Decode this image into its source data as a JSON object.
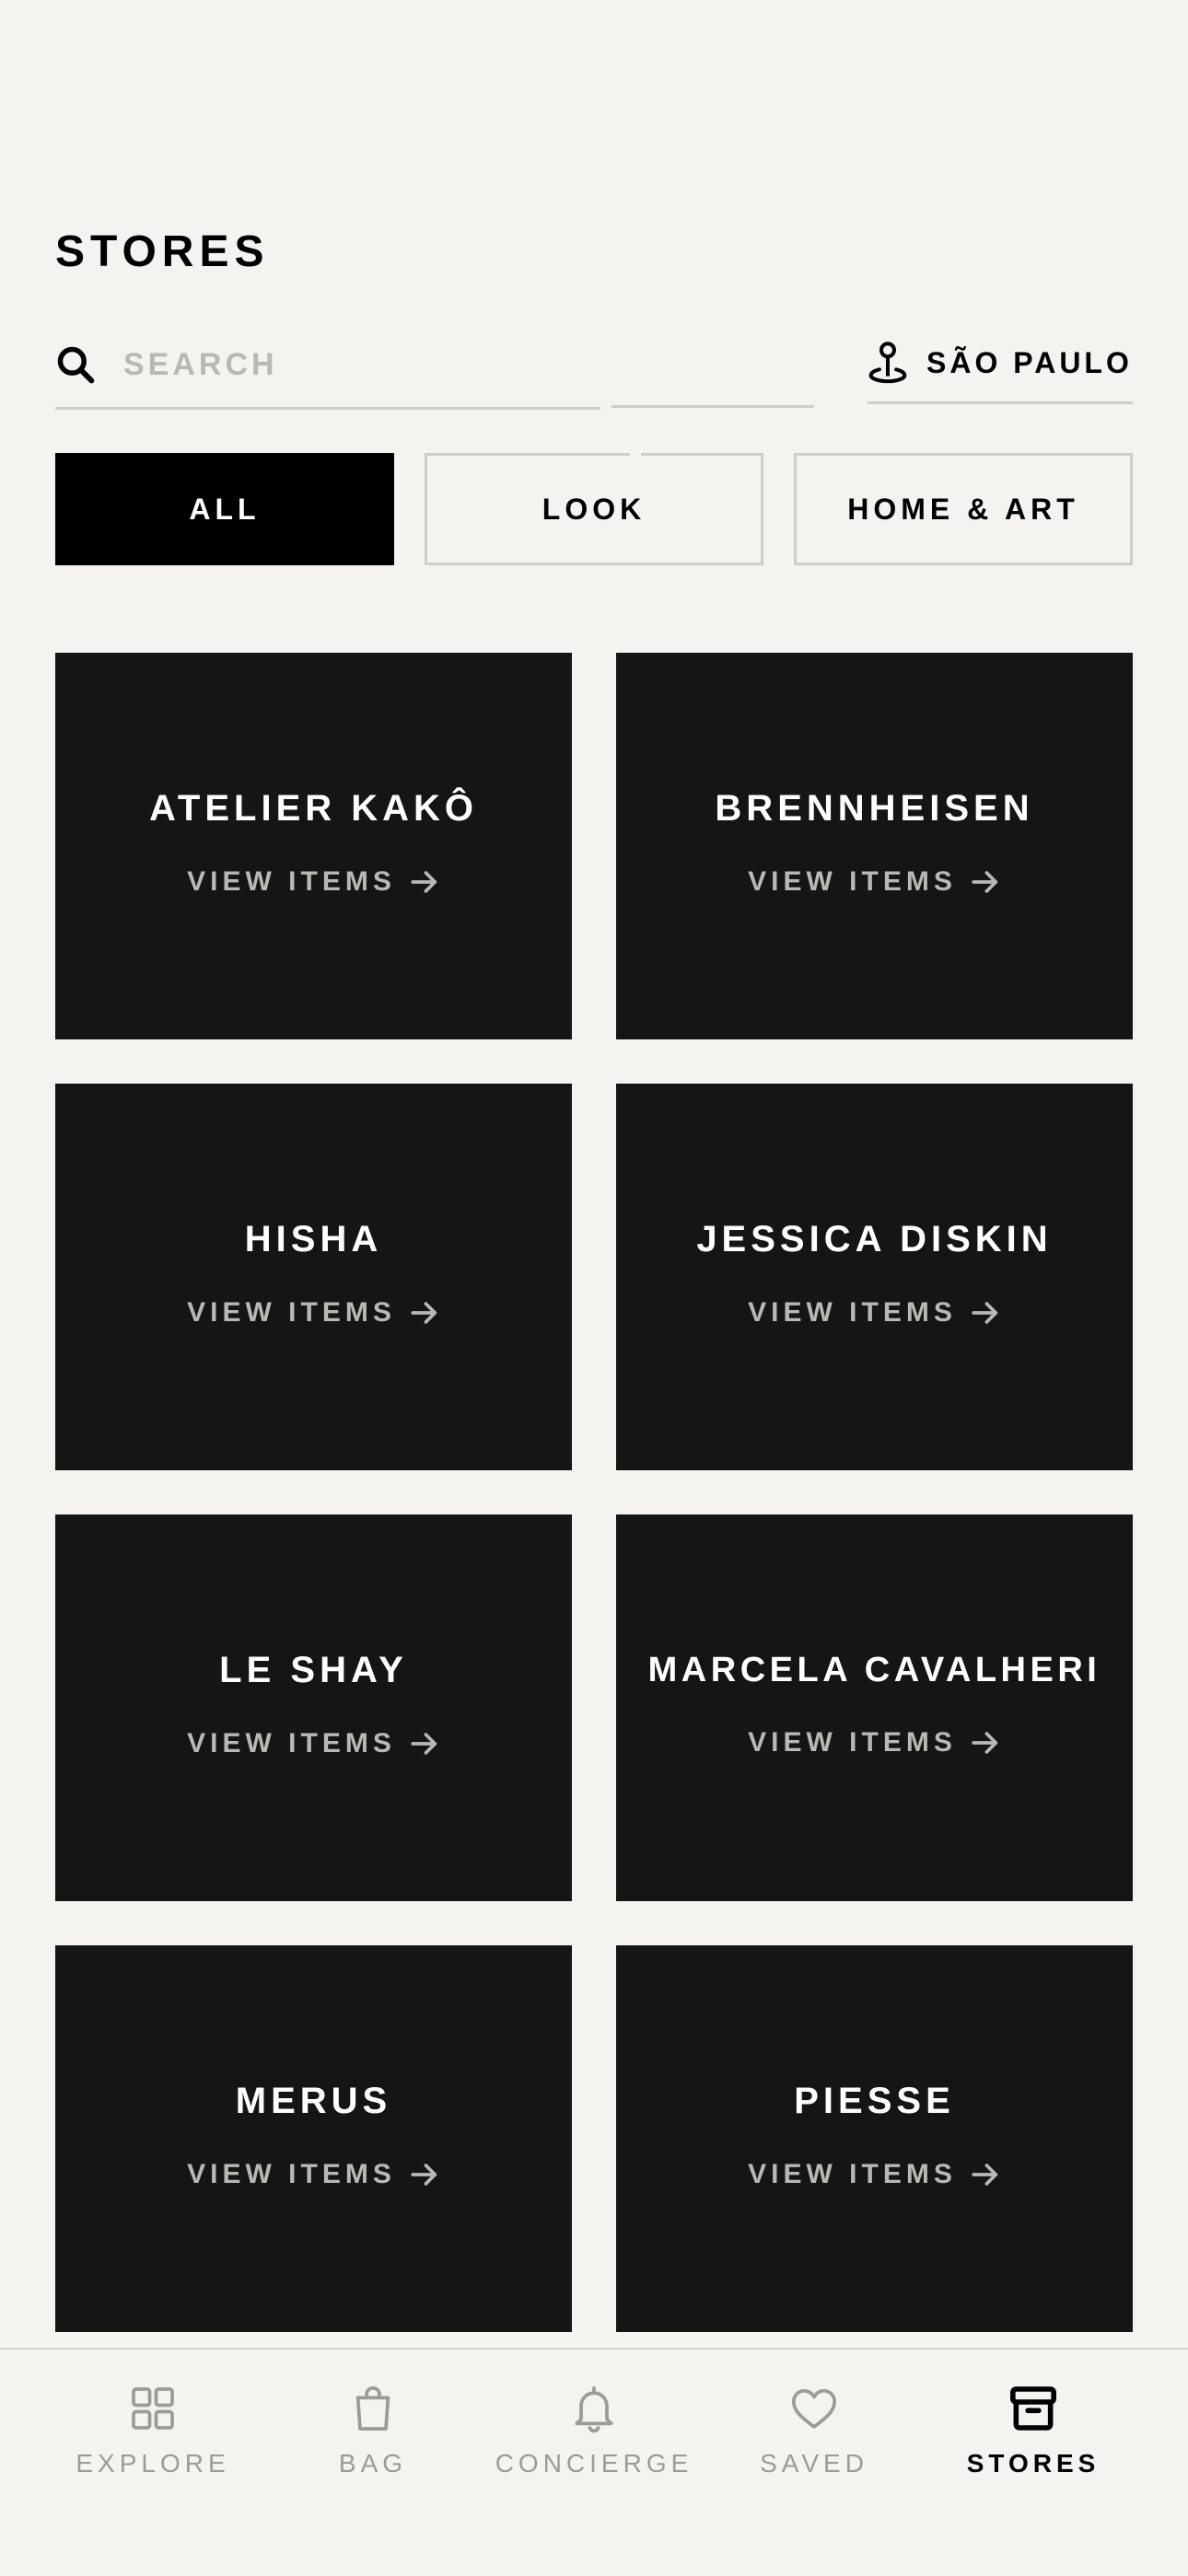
{
  "header": {
    "title": "STORES"
  },
  "search": {
    "placeholder": "SEARCH",
    "value": ""
  },
  "location": {
    "label": "SÃO PAULO"
  },
  "filters": [
    {
      "label": "ALL",
      "active": true
    },
    {
      "label": "LOOK",
      "active": false
    },
    {
      "label": "HOME & ART",
      "active": false
    }
  ],
  "stores": [
    {
      "name": "ATELIER KAKÔ",
      "link": "VIEW ITEMS"
    },
    {
      "name": "BRENNHEISEN",
      "link": "VIEW ITEMS"
    },
    {
      "name": "HISHA",
      "link": "VIEW ITEMS"
    },
    {
      "name": "JESSICA DISKIN",
      "link": "VIEW ITEMS"
    },
    {
      "name": "LE SHAY",
      "link": "VIEW ITEMS"
    },
    {
      "name": "MARCELA CAVALHERI",
      "link": "VIEW ITEMS"
    },
    {
      "name": "MERUS",
      "link": "VIEW ITEMS"
    },
    {
      "name": "PIESSE",
      "link": "VIEW ITEMS"
    }
  ],
  "tabbar": {
    "items": [
      {
        "label": "EXPLORE",
        "icon": "grid-icon",
        "active": false
      },
      {
        "label": "BAG",
        "icon": "bag-icon",
        "active": false
      },
      {
        "label": "CONCIERGE",
        "icon": "bell-icon",
        "active": false
      },
      {
        "label": "SAVED",
        "icon": "heart-icon",
        "active": false
      },
      {
        "label": "STORES",
        "icon": "store-box-icon",
        "active": true
      }
    ]
  },
  "colors": {
    "background": "#f4f3ef",
    "card": "#151515",
    "accent": "#000000",
    "muted_text": "#b9b8b4",
    "inactive_tab": "#9c9b97",
    "divider": "#cfcdc8"
  }
}
